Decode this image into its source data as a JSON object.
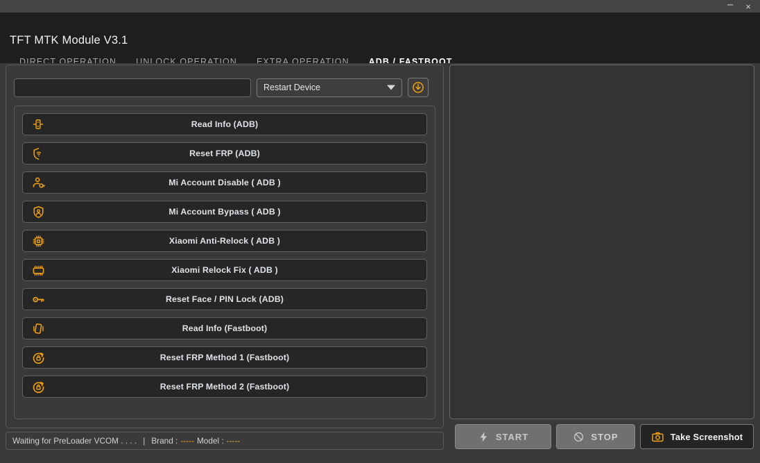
{
  "window": {
    "minimize_label": "–",
    "close_label": "×",
    "minimize_icon": "minimize-icon",
    "close_icon": "close-icon"
  },
  "header": {
    "app_title": "TFT MTK Module V3.1",
    "tabs": [
      {
        "label": "DIRECT OPERATION",
        "active": false
      },
      {
        "label": "UNLOCK OPERATION",
        "active": false
      },
      {
        "label": "EXTRA OPERATION",
        "active": false
      },
      {
        "label": "ADB / FASTBOOT",
        "active": true
      }
    ],
    "active_tab": "ADB / FASTBOOT",
    "accent_color": "#f0a010"
  },
  "toolbar": {
    "input_value": "",
    "input_placeholder": "",
    "dropdown_selected": "Restart Device",
    "dropdown_icon": "chevron-down-icon",
    "run_button_icon": "power-download-icon"
  },
  "operations": [
    {
      "label": "Read Info (ADB)",
      "icon": "device-detect-icon"
    },
    {
      "label": "Reset FRP (ADB)",
      "icon": "shield-wifi-icon"
    },
    {
      "label": "Mi Account Disable ( ADB )",
      "icon": "user-key-icon"
    },
    {
      "label": "Mi Account Bypass ( ADB )",
      "icon": "shield-user-icon"
    },
    {
      "label": "Xiaomi Anti-Relock ( ADB )",
      "icon": "chip-dashed-icon"
    },
    {
      "label": "Xiaomi Relock Fix ( ADB )",
      "icon": "chip-icon"
    },
    {
      "label": "Reset Face / PIN Lock (ADB)",
      "icon": "key-icon"
    },
    {
      "label": "Read Info (Fastboot)",
      "icon": "phone-rotate-icon"
    },
    {
      "label": "Reset FRP Method 1 (Fastboot)",
      "icon": "lock-refresh-icon"
    },
    {
      "label": "Reset FRP Method 2 (Fastboot)",
      "icon": "lock-refresh-icon"
    }
  ],
  "status": {
    "message": "Waiting for PreLoader VCOM . . . .",
    "separator": "|",
    "brand_key": "Brand :",
    "brand_value": "-----",
    "model_key": "Model :",
    "model_value": "-----",
    "value_color": "#f0a010"
  },
  "log": {
    "content": ""
  },
  "actions": {
    "start": {
      "label": "START",
      "icon": "bolt-icon",
      "enabled": false
    },
    "stop": {
      "label": "STOP",
      "icon": "no-entry-icon",
      "enabled": false
    },
    "screenshot": {
      "label": "Take Screenshot",
      "icon": "camera-icon",
      "enabled": true
    }
  }
}
